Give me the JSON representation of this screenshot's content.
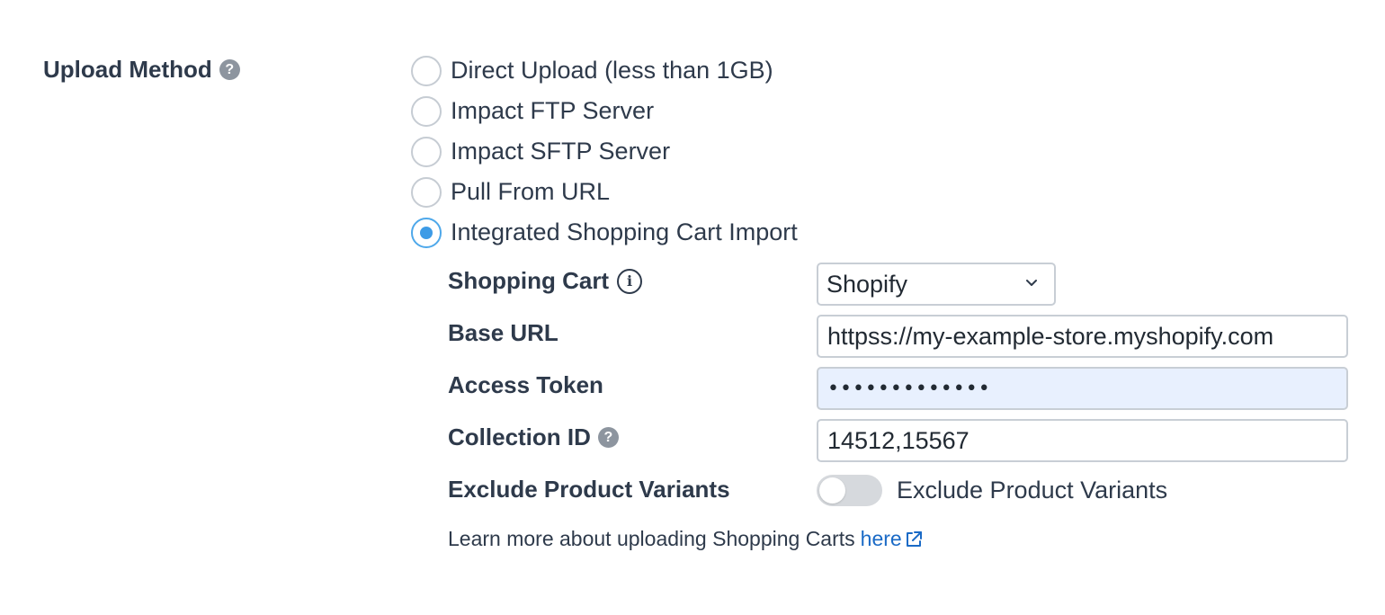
{
  "upload_method": {
    "label": "Upload Method",
    "help_icon": "question-circle-icon",
    "options": [
      {
        "label": "Direct Upload (less than 1GB)",
        "selected": false
      },
      {
        "label": "Impact FTP Server",
        "selected": false
      },
      {
        "label": "Impact SFTP Server",
        "selected": false
      },
      {
        "label": "Pull From URL",
        "selected": false
      },
      {
        "label": "Integrated Shopping Cart Import",
        "selected": true
      }
    ],
    "accent_color": "#3d9be6"
  },
  "shopping_cart": {
    "label": "Shopping Cart",
    "info_icon": "info-circle-icon",
    "selected_value": "Shopify",
    "dropdown_icon": "chevron-down-icon"
  },
  "base_url": {
    "label": "Base URL",
    "value": "httpss://my-example-store.myshopify.com"
  },
  "access_token": {
    "label": "Access Token",
    "value": "•••••••••••••",
    "autofill_color": "#e8f0fe"
  },
  "collection_id": {
    "label": "Collection ID",
    "help_icon": "question-circle-icon",
    "value": "14512,15567"
  },
  "exclude_variants": {
    "label": "Exclude Product Variants",
    "toggle_label": "Exclude Product Variants",
    "enabled": false
  },
  "help": {
    "text": "Learn more about uploading Shopping Carts",
    "link_text": "here",
    "link_icon": "external-link-icon",
    "link_color": "#1a6ac6"
  }
}
